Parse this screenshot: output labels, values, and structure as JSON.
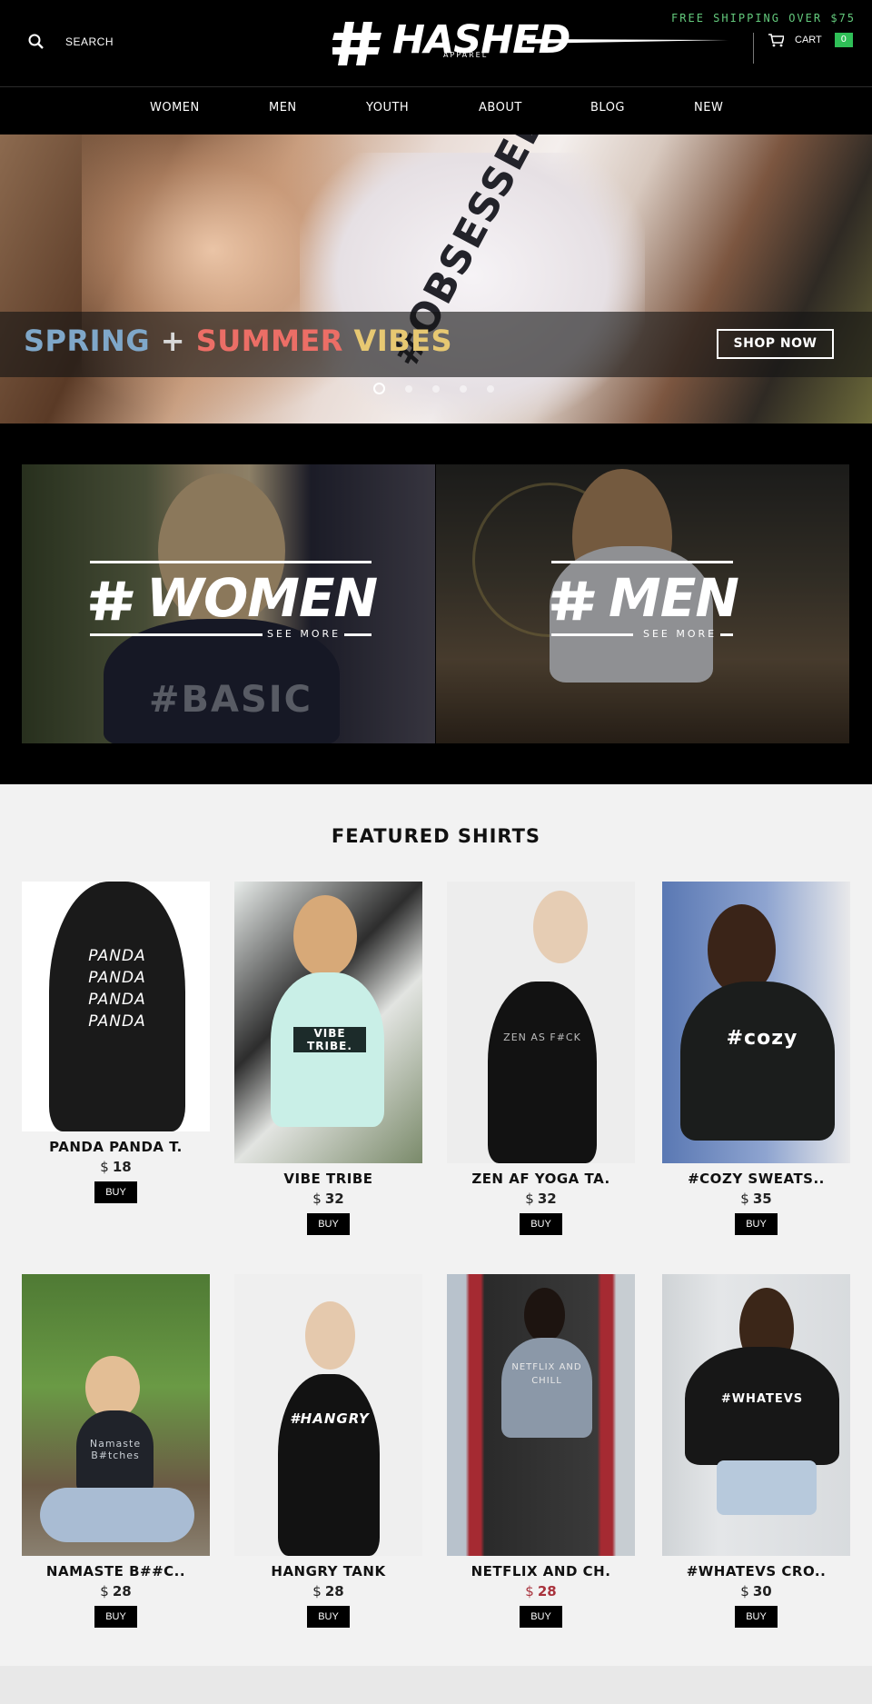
{
  "header": {
    "search_label": "SEARCH",
    "logo_text": "HASHED",
    "logo_sub": "APPAREL",
    "shipping": "FREE SHIPPING OVER $75",
    "cart_label": "CART",
    "cart_count": "0"
  },
  "nav": [
    "WOMEN",
    "MEN",
    "YOUTH",
    "ABOUT",
    "BLOG",
    "NEW"
  ],
  "hero": {
    "title_part1": "SPRING",
    "title_plus": "+",
    "title_part2": "SUMMER",
    "title_part3": "VIBES",
    "shop_now": "SHOP NOW",
    "shirt_print": "#OBSESSED",
    "slide_count": 5,
    "active_slide": 1
  },
  "categories": [
    {
      "title": "WOMEN",
      "see_more": "SEE MORE",
      "shirt_print": "#BASIC"
    },
    {
      "title": "MEN",
      "see_more": "SEE MORE"
    }
  ],
  "featured": {
    "title": "FEATURED SHIRTS",
    "currency": "$",
    "buy_label": "BUY",
    "products": [
      {
        "name": "PANDA PANDA T.",
        "price": "18",
        "sale": false,
        "print": "PANDA PANDA PANDA PANDA"
      },
      {
        "name": "VIBE TRIBE",
        "price": "32",
        "sale": false,
        "print": "VIBE TRIBE."
      },
      {
        "name": "ZEN AF YOGA TA.",
        "price": "32",
        "sale": false,
        "print": "ZEN AS F#CK"
      },
      {
        "name": "#COZY SWEATS..",
        "price": "35",
        "sale": false,
        "print": "#cozy"
      },
      {
        "name": "NAMASTE B##C..",
        "price": "28",
        "sale": false,
        "print": "Namaste B#tches"
      },
      {
        "name": "HANGRY TANK",
        "price": "28",
        "sale": false,
        "print": "#HANGRY"
      },
      {
        "name": "NETFLIX AND CH.",
        "price": "28",
        "sale": true,
        "print": "NETFLIX AND CHILL"
      },
      {
        "name": "#WHATEVS CRO..",
        "price": "30",
        "sale": false,
        "print": "#WHATEVS"
      }
    ]
  },
  "colors": {
    "accent_green": "#2fbf57",
    "shipping_green": "#63c97c",
    "sale_red": "#a8323c"
  }
}
